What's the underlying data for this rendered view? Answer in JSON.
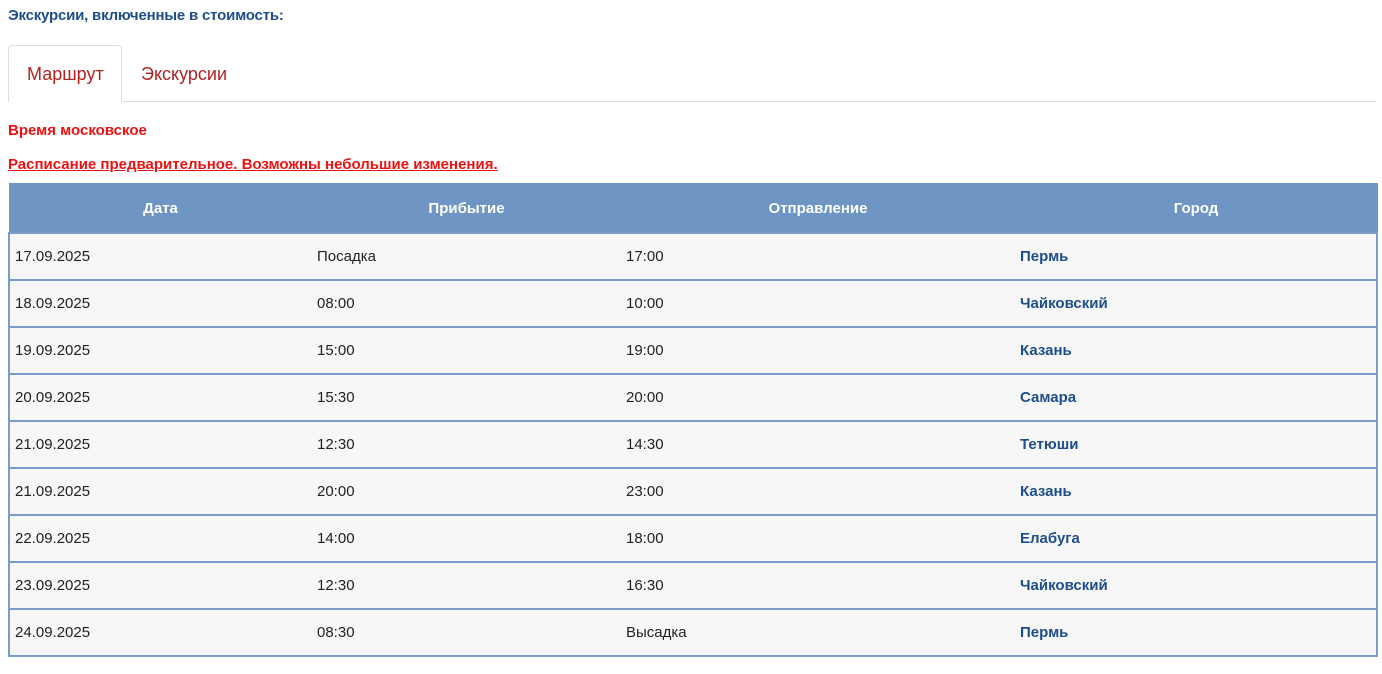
{
  "section_heading": "Экскурсии, включенные в стоимость:",
  "tabs": [
    {
      "label": "Маршрут",
      "active": true
    },
    {
      "label": "Экскурсии",
      "active": false
    }
  ],
  "notices": {
    "time": "Время московское",
    "schedule": "Расписание предварительное. Возможны небольшие изменения."
  },
  "colors": {
    "accent_blue": "#1f4e8c",
    "tab_red": "#b22222",
    "notice_red": "#ee1111",
    "header_bg": "#6e95c4"
  },
  "table": {
    "headers": [
      "Дата",
      "Прибытие",
      "Отправление",
      "Город"
    ],
    "rows": [
      {
        "date": "17.09.2025",
        "arrival": "Посадка",
        "departure": "17:00",
        "city": "Пермь"
      },
      {
        "date": "18.09.2025",
        "arrival": "08:00",
        "departure": "10:00",
        "city": "Чайковский"
      },
      {
        "date": "19.09.2025",
        "arrival": "15:00",
        "departure": "19:00",
        "city": "Казань"
      },
      {
        "date": "20.09.2025",
        "arrival": "15:30",
        "departure": "20:00",
        "city": "Самара"
      },
      {
        "date": "21.09.2025",
        "arrival": "12:30",
        "departure": "14:30",
        "city": "Тетюши"
      },
      {
        "date": "21.09.2025",
        "arrival": "20:00",
        "departure": "23:00",
        "city": "Казань"
      },
      {
        "date": "22.09.2025",
        "arrival": "14:00",
        "departure": "18:00",
        "city": "Елабуга"
      },
      {
        "date": "23.09.2025",
        "arrival": "12:30",
        "departure": "16:30",
        "city": "Чайковский"
      },
      {
        "date": "24.09.2025",
        "arrival": "08:30",
        "departure": "Высадка",
        "city": "Пермь"
      }
    ]
  }
}
